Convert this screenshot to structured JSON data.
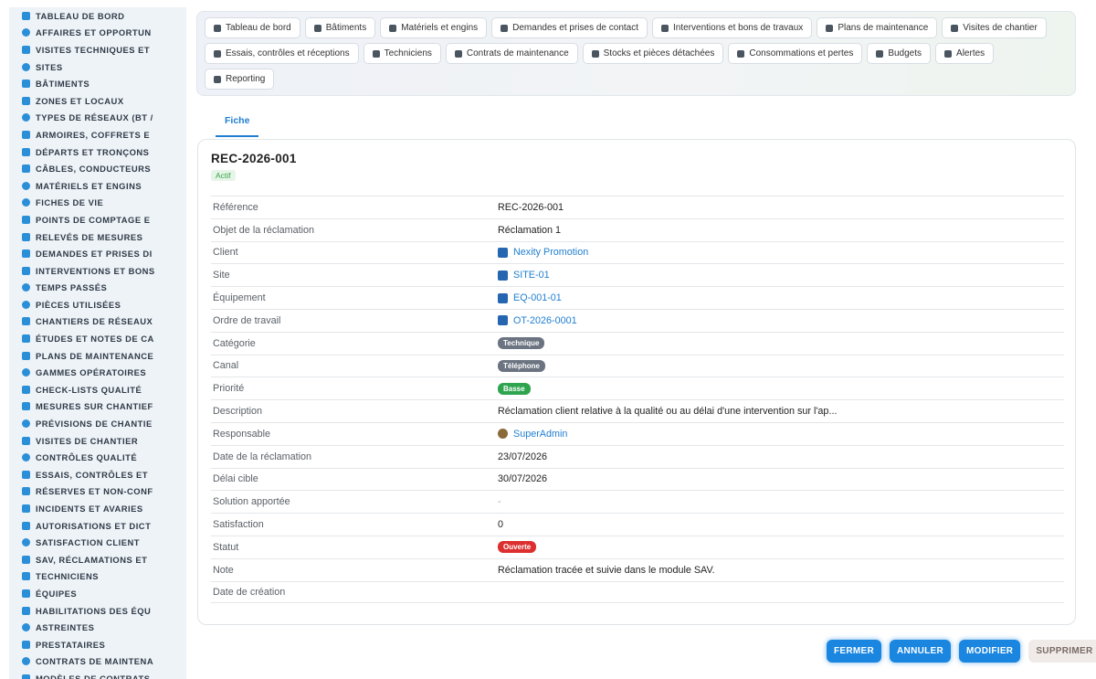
{
  "sidebar": {
    "items": [
      {
        "label": "TABLEAU DE BORD",
        "icon": "dashboard-icon"
      },
      {
        "label": "AFFAIRES ET OPPORTUN",
        "icon": "target-icon"
      },
      {
        "label": "VISITES TECHNIQUES ET",
        "icon": "clipboard-icon"
      },
      {
        "label": "SITES",
        "icon": "map-pin-icon"
      },
      {
        "label": "BÂTIMENTS",
        "icon": "building-icon"
      },
      {
        "label": "ZONES ET LOCAUX",
        "icon": "grid-icon"
      },
      {
        "label": "TYPES DE RÉSEAUX (BT /",
        "icon": "network-icon"
      },
      {
        "label": "ARMOIRES, COFFRETS E",
        "icon": "cabinet-icon"
      },
      {
        "label": "DÉPARTS ET TRONÇONS",
        "icon": "route-icon"
      },
      {
        "label": "CÂBLES, CONDUCTEURS",
        "icon": "cable-icon"
      },
      {
        "label": "MATÉRIELS ET ENGINS",
        "icon": "gears-icon"
      },
      {
        "label": "FICHES DE VIE",
        "icon": "history-icon"
      },
      {
        "label": "POINTS DE COMPTAGE E",
        "icon": "gauge-icon"
      },
      {
        "label": "RELEVÉS DE MESURES",
        "icon": "clipboard-list-icon"
      },
      {
        "label": "DEMANDES ET PRISES DI",
        "icon": "question-icon"
      },
      {
        "label": "INTERVENTIONS ET BONS",
        "icon": "clipboard-check-icon"
      },
      {
        "label": "TEMPS PASSÉS",
        "icon": "clock-icon"
      },
      {
        "label": "PIÈCES UTILISÉES",
        "icon": "puzzle-icon"
      },
      {
        "label": "CHANTIERS DE RÉSEAUX",
        "icon": "hammer-icon"
      },
      {
        "label": "ÉTUDES ET NOTES DE CA",
        "icon": "compass-icon"
      },
      {
        "label": "PLANS DE MAINTENANCE",
        "icon": "calendar-icon"
      },
      {
        "label": "GAMMES OPÉRATOIRES",
        "icon": "list-icon"
      },
      {
        "label": "CHECK-LISTS QUALITÉ",
        "icon": "check-square-icon"
      },
      {
        "label": "MESURES SUR CHANTIEF",
        "icon": "thermometer-icon"
      },
      {
        "label": "PRÉVISIONS DE CHANTIE",
        "icon": "chart-line-icon"
      },
      {
        "label": "VISITES DE CHANTIER",
        "icon": "walk-icon"
      },
      {
        "label": "CONTRÔLES QUALITÉ",
        "icon": "shield-check-icon"
      },
      {
        "label": "ESSAIS, CONTRÔLES ET",
        "icon": "clipboard-check-icon"
      },
      {
        "label": "RÉSERVES ET NON-CONF",
        "icon": "alert-circle-icon"
      },
      {
        "label": "INCIDENTS ET AVARIES",
        "icon": "warning-icon"
      },
      {
        "label": "AUTORISATIONS ET DICT",
        "icon": "file-signature-icon"
      },
      {
        "label": "SATISFACTION CLIENT",
        "icon": "smile-icon"
      },
      {
        "label": "SAV, RÉCLAMATIONS ET",
        "icon": "comment-icon"
      },
      {
        "label": "TECHNICIENS",
        "icon": "hard-hat-icon"
      },
      {
        "label": "ÉQUIPES",
        "icon": "users-icon"
      },
      {
        "label": "HABILITATIONS DES ÉQU",
        "icon": "certificate-icon"
      },
      {
        "label": "ASTREINTES",
        "icon": "phone-icon"
      },
      {
        "label": "PRESTATAIRES",
        "icon": "handshake-icon"
      },
      {
        "label": "CONTRATS DE MAINTENA",
        "icon": "file-contract-icon"
      },
      {
        "label": "MODÈLES DE CONTRATS",
        "icon": "copy-icon"
      }
    ]
  },
  "topnav": {
    "buttons": [
      {
        "label": "Tableau de bord",
        "icon": "dashboard-icon"
      },
      {
        "label": "Bâtiments",
        "icon": "building-icon"
      },
      {
        "label": "Matériels et engins",
        "icon": "gears-icon"
      },
      {
        "label": "Demandes et prises de contact",
        "icon": "question-icon"
      },
      {
        "label": "Interventions et bons de travaux",
        "icon": "clipboard-check-icon"
      },
      {
        "label": "Plans de maintenance",
        "icon": "calendar-icon"
      },
      {
        "label": "Visites de chantier",
        "icon": "walk-icon"
      },
      {
        "label": "Essais, contrôles et réceptions",
        "icon": "clipboard-check-icon"
      },
      {
        "label": "Techniciens",
        "icon": "hard-hat-icon"
      },
      {
        "label": "Contrats de maintenance",
        "icon": "file-contract-icon"
      },
      {
        "label": "Stocks et pièces détachées",
        "icon": "boxes-icon"
      },
      {
        "label": "Consommations et pertes",
        "icon": "bolt-icon"
      },
      {
        "label": "Budgets",
        "icon": "money-icon"
      },
      {
        "label": "Alertes",
        "icon": "bell-icon"
      },
      {
        "label": "Reporting",
        "icon": "pie-chart-icon"
      }
    ]
  },
  "tabs": {
    "fiche": "Fiche"
  },
  "record": {
    "title": "REC-2026-001",
    "status_badge": "Actif",
    "rows": [
      {
        "key": "Référence",
        "value": "REC-2026-001",
        "kind": "text"
      },
      {
        "key": "Objet de la réclamation",
        "value": "Réclamation 1",
        "kind": "text"
      },
      {
        "key": "Client",
        "value": "Nexity Promotion",
        "kind": "link",
        "icon": "building-icon"
      },
      {
        "key": "Site",
        "value": "SITE-01",
        "kind": "link",
        "icon": "map-icon"
      },
      {
        "key": "Équipement",
        "value": "EQ-001-01",
        "kind": "link",
        "icon": "map-icon"
      },
      {
        "key": "Ordre de travail",
        "value": "OT-2026-0001",
        "kind": "link",
        "icon": "map-icon"
      },
      {
        "key": "Catégorie",
        "value": "Technique",
        "kind": "badge",
        "color": "#6b7480"
      },
      {
        "key": "Canal",
        "value": "Téléphone",
        "kind": "badge",
        "color": "#6b7480"
      },
      {
        "key": "Priorité",
        "value": "Basse",
        "kind": "badge",
        "color": "#2ea44f"
      },
      {
        "key": "Description",
        "value": "Réclamation client relative à la qualité ou au délai d'une intervention sur l'ap...",
        "kind": "text"
      },
      {
        "key": "Responsable",
        "value": "SuperAdmin",
        "kind": "link",
        "icon": "user-icon"
      },
      {
        "key": "Date de la réclamation",
        "value": "23/07/2026",
        "kind": "text"
      },
      {
        "key": "Délai cible",
        "value": "30/07/2026",
        "kind": "text"
      },
      {
        "key": "Solution apportée",
        "value": "-",
        "kind": "muted"
      },
      {
        "key": "Satisfaction",
        "value": "0",
        "kind": "text"
      },
      {
        "key": "Statut",
        "value": "Ouverte",
        "kind": "badge",
        "color": "#dc3030"
      },
      {
        "key": "Note",
        "value": "Réclamation tracée et suivie dans le module SAV.",
        "kind": "text"
      },
      {
        "key": "Date de création",
        "value": "",
        "kind": "text"
      }
    ]
  },
  "footer": {
    "fermer": "FERMER",
    "annuler": "ANNULER",
    "modifier": "MODIFIER",
    "supprimer": "SUPPRIMER"
  }
}
